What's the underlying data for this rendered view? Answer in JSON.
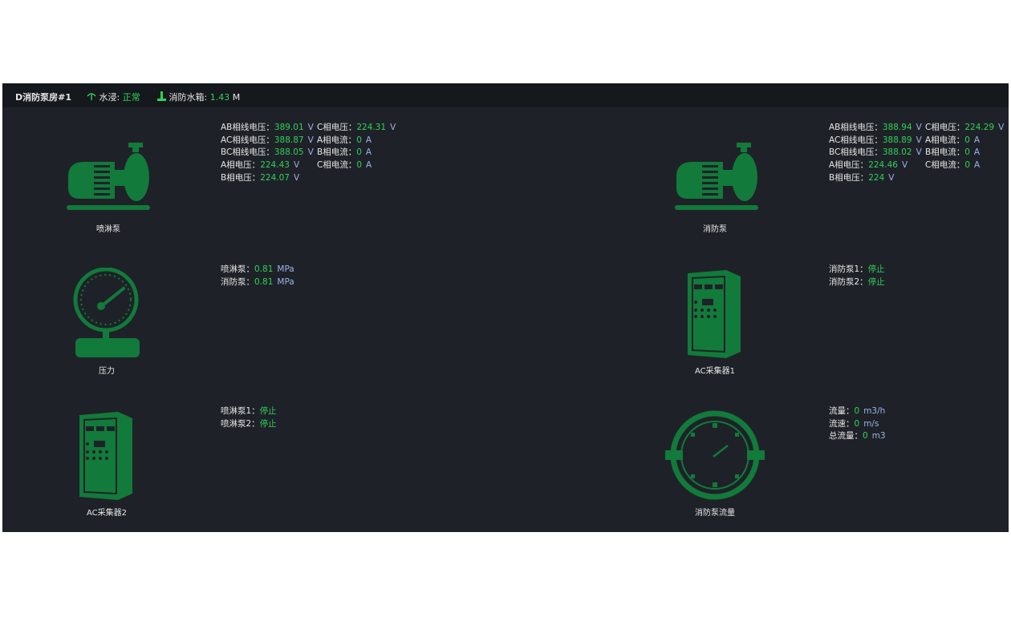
{
  "header": {
    "room": "D消防泵房#1",
    "flood_label": "水浸:",
    "flood_value": "正常",
    "tank_label": "消防水箱:",
    "tank_value": "1.43",
    "tank_unit": "M"
  },
  "colors": {
    "accent_green": "#30d158",
    "icon_green": "#127a3a",
    "unit_blue": "#9db1e6",
    "panel_bg": "#1e2228"
  },
  "devices": {
    "spray_pump": {
      "name": "喷淋泵",
      "icon": "pump-icon",
      "col1": [
        {
          "label": "AB相线电压：",
          "value": "389.01",
          "unit": "V"
        },
        {
          "label": "AC相线电压：",
          "value": "388.87",
          "unit": "V"
        },
        {
          "label": "BC相线电压：",
          "value": "388.05",
          "unit": "V"
        },
        {
          "label": "A相电压：",
          "value": "224.43",
          "unit": "V"
        },
        {
          "label": "B相电压：",
          "value": "224.07",
          "unit": "V"
        }
      ],
      "col2": [
        {
          "label": "C相电压：",
          "value": "224.31",
          "unit": "V"
        },
        {
          "label": "A相电流：",
          "value": "0",
          "unit": "A"
        },
        {
          "label": "B相电流：",
          "value": "0",
          "unit": "A"
        },
        {
          "label": "C相电流：",
          "value": "0",
          "unit": "A"
        }
      ]
    },
    "fire_pump": {
      "name": "消防泵",
      "icon": "pump-icon",
      "col1": [
        {
          "label": "AB相线电压：",
          "value": "388.94",
          "unit": "V"
        },
        {
          "label": "AC相线电压：",
          "value": "388.89",
          "unit": "V"
        },
        {
          "label": "BC相线电压：",
          "value": "388.02",
          "unit": "V"
        },
        {
          "label": "A相电压：",
          "value": "224.46",
          "unit": "V"
        },
        {
          "label": "B相电压：",
          "value": "224",
          "unit": "V"
        }
      ],
      "col2": [
        {
          "label": "C相电压：",
          "value": "224.29",
          "unit": "V"
        },
        {
          "label": "A相电流：",
          "value": "0",
          "unit": "A"
        },
        {
          "label": "B相电流：",
          "value": "0",
          "unit": "A"
        },
        {
          "label": "C相电流：",
          "value": "0",
          "unit": "A"
        }
      ]
    },
    "pressure": {
      "name": "压力",
      "icon": "pressure-gauge-icon",
      "rows": [
        {
          "label": "喷淋泵：",
          "value": "0.81",
          "unit": "MPa"
        },
        {
          "label": "消防泵：",
          "value": "0.81",
          "unit": "MPa"
        }
      ]
    },
    "ac_collector1": {
      "name": "AC采集器1",
      "icon": "control-cabinet-icon",
      "rows": [
        {
          "label": "消防泵1：",
          "value": "停止"
        },
        {
          "label": "消防泵2：",
          "value": "停止"
        }
      ]
    },
    "ac_collector2": {
      "name": "AC采集器2",
      "icon": "control-cabinet-icon",
      "rows": [
        {
          "label": "喷淋泵1：",
          "value": "停止"
        },
        {
          "label": "喷淋泵2：",
          "value": "停止"
        }
      ]
    },
    "flow": {
      "name": "消防泵流量",
      "icon": "flow-meter-icon",
      "rows": [
        {
          "label": "流量：",
          "value": "0",
          "unit": "m3/h"
        },
        {
          "label": "流速：",
          "value": "0",
          "unit": "m/s"
        },
        {
          "label": "总流量：",
          "value": "0",
          "unit": "m3"
        }
      ]
    }
  }
}
